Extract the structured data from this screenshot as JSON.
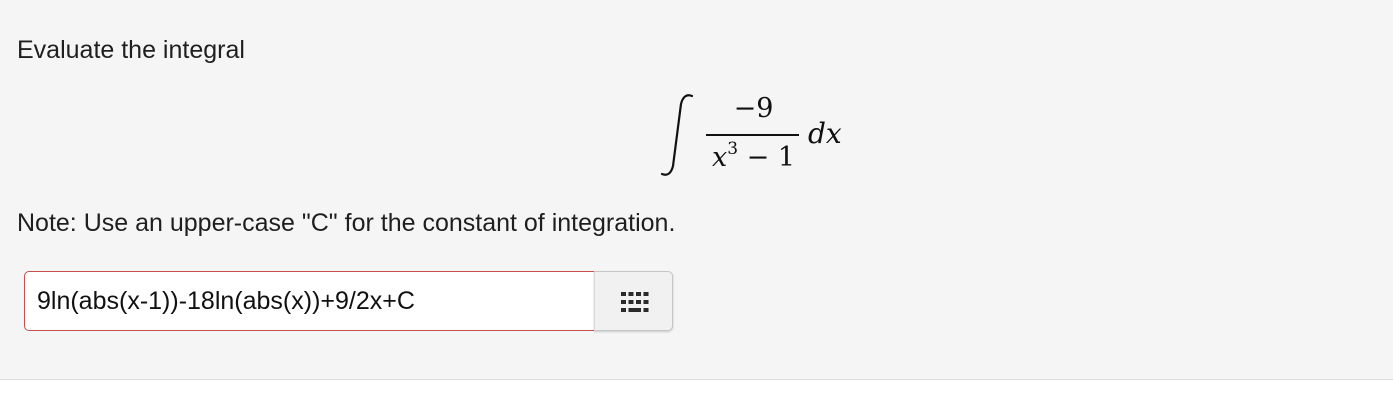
{
  "question": {
    "prompt": "Evaluate the integral",
    "integral": {
      "numerator": "−9",
      "denominator_var": "x",
      "denominator_exp": "3",
      "denominator_rest": " − 1",
      "differential": "dx"
    },
    "note": "Note: Use an upper-case \"C\" for the constant of integration."
  },
  "answer": {
    "value": "9ln(abs(x-1))-18ln(abs(x))+9/2x+C",
    "border_color": "#c94f4f",
    "keypad_icon": "keypad-grid-icon"
  }
}
